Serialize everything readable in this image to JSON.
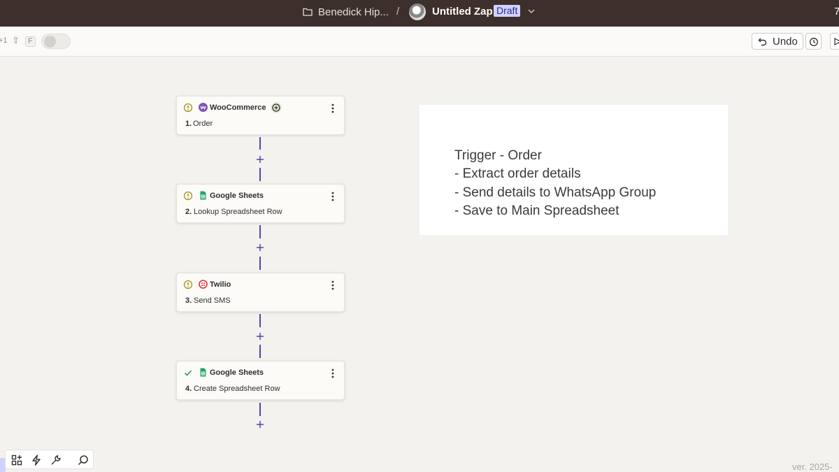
{
  "header": {
    "folder_name": "Benedick Hip...",
    "separator": "/",
    "zap_title": "Untitled Zap",
    "status_badge": "Draft",
    "right_clip": "7"
  },
  "toolbar": {
    "shortcut_1": "+1",
    "shortcut_2": "⇧",
    "shortcut_3": "F",
    "undo_label": "Undo"
  },
  "steps": [
    {
      "app": "WooCommerce",
      "number": "1.",
      "title": "Order",
      "status": "warning"
    },
    {
      "app": "Google Sheets",
      "number": "2.",
      "title": "Lookup Spreadsheet Row",
      "status": "warning"
    },
    {
      "app": "Twilio",
      "number": "3.",
      "title": "Send SMS",
      "status": "warning"
    },
    {
      "app": "Google Sheets",
      "number": "4.",
      "title": "Create Spreadsheet Row",
      "status": "complete"
    }
  ],
  "note": {
    "lines": [
      "Trigger - Order",
      "- Extract order details",
      "- Send details to WhatsApp Group",
      "- Save to Main Spreadsheet"
    ]
  },
  "footer": {
    "version": "ver. 2025-"
  },
  "colors": {
    "topbar": "#3d2f2b",
    "connector": "#4f46a8",
    "badge_bg": "#cfd3ff",
    "warning": "#a08a00",
    "success": "#2e8b57"
  }
}
